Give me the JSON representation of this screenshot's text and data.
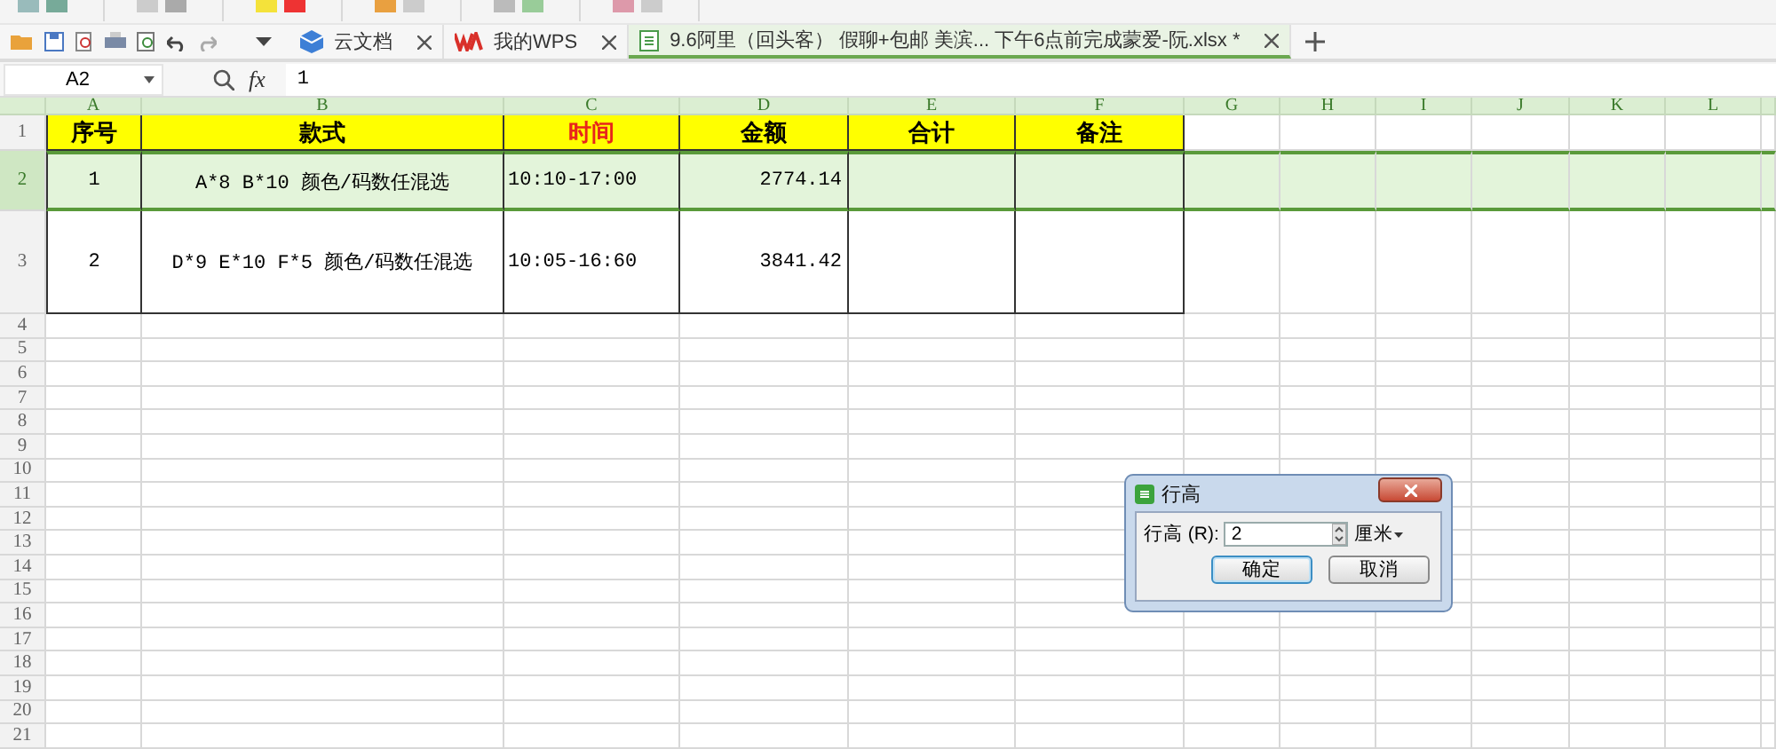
{
  "tabs": [
    {
      "label": "云文档",
      "kind": "cloud",
      "selected": false
    },
    {
      "label": "我的WPS",
      "kind": "wps",
      "selected": false
    },
    {
      "label": "9.6阿里（回头客） 假聊+包邮 美滨... 下午6点前完成蒙爱-阮.xlsx *",
      "kind": "sheet",
      "selected": true
    }
  ],
  "formula_bar": {
    "cell_ref": "A2",
    "fx": "fx",
    "value": "1"
  },
  "sheet": {
    "columns": [
      "A",
      "B",
      "C",
      "D",
      "E",
      "F",
      "G",
      "H",
      "I",
      "J",
      "K",
      "L"
    ],
    "rows": [
      {
        "header": "1",
        "kind": "title",
        "selected": false,
        "cells": [
          {
            "text": "序号"
          },
          {
            "text": "款式"
          },
          {
            "text": "时间",
            "emphasis": true
          },
          {
            "text": "金额"
          },
          {
            "text": "合计"
          },
          {
            "text": "备注"
          }
        ]
      },
      {
        "header": "2",
        "kind": "data",
        "selected": true,
        "cells": [
          {
            "text": "1"
          },
          {
            "text": "A*8  B*10  颜色/码数任混选"
          },
          {
            "text": "10:10-17:00"
          },
          {
            "text": "2774.14"
          }
        ]
      },
      {
        "header": "3",
        "kind": "data",
        "selected": false,
        "cells": [
          {
            "text": "2"
          },
          {
            "text": "D*9 E*10 F*5  颜色/码数任混选"
          },
          {
            "text": "10:05-16:60"
          },
          {
            "text": "3841.42"
          }
        ]
      },
      {
        "header": "4",
        "kind": "blank",
        "selected": false
      },
      {
        "header": "5",
        "kind": "blank",
        "selected": false
      },
      {
        "header": "6",
        "kind": "blank",
        "selected": false
      },
      {
        "header": "7",
        "kind": "blank",
        "selected": false
      },
      {
        "header": "8",
        "kind": "blank",
        "selected": false
      },
      {
        "header": "9",
        "kind": "blank",
        "selected": false
      },
      {
        "header": "10",
        "kind": "blank",
        "selected": false
      },
      {
        "header": "11",
        "kind": "blank",
        "selected": false
      },
      {
        "header": "12",
        "kind": "blank",
        "selected": false
      },
      {
        "header": "13",
        "kind": "blank",
        "selected": false
      },
      {
        "header": "14",
        "kind": "blank",
        "selected": false
      },
      {
        "header": "15",
        "kind": "blank",
        "selected": false
      },
      {
        "header": "16",
        "kind": "blank",
        "selected": false
      },
      {
        "header": "17",
        "kind": "blank",
        "selected": false
      },
      {
        "header": "18",
        "kind": "blank",
        "selected": false
      },
      {
        "header": "19",
        "kind": "blank",
        "selected": false
      },
      {
        "header": "20",
        "kind": "blank",
        "selected": false
      },
      {
        "header": "21",
        "kind": "blank",
        "selected": false
      }
    ]
  },
  "dialog": {
    "title": "行高",
    "label": "行高 (R):",
    "value": "2",
    "unit": "厘米",
    "buttons": [
      {
        "label": "确定",
        "kind": "primary"
      },
      {
        "label": "取消",
        "kind": "normal"
      }
    ]
  }
}
